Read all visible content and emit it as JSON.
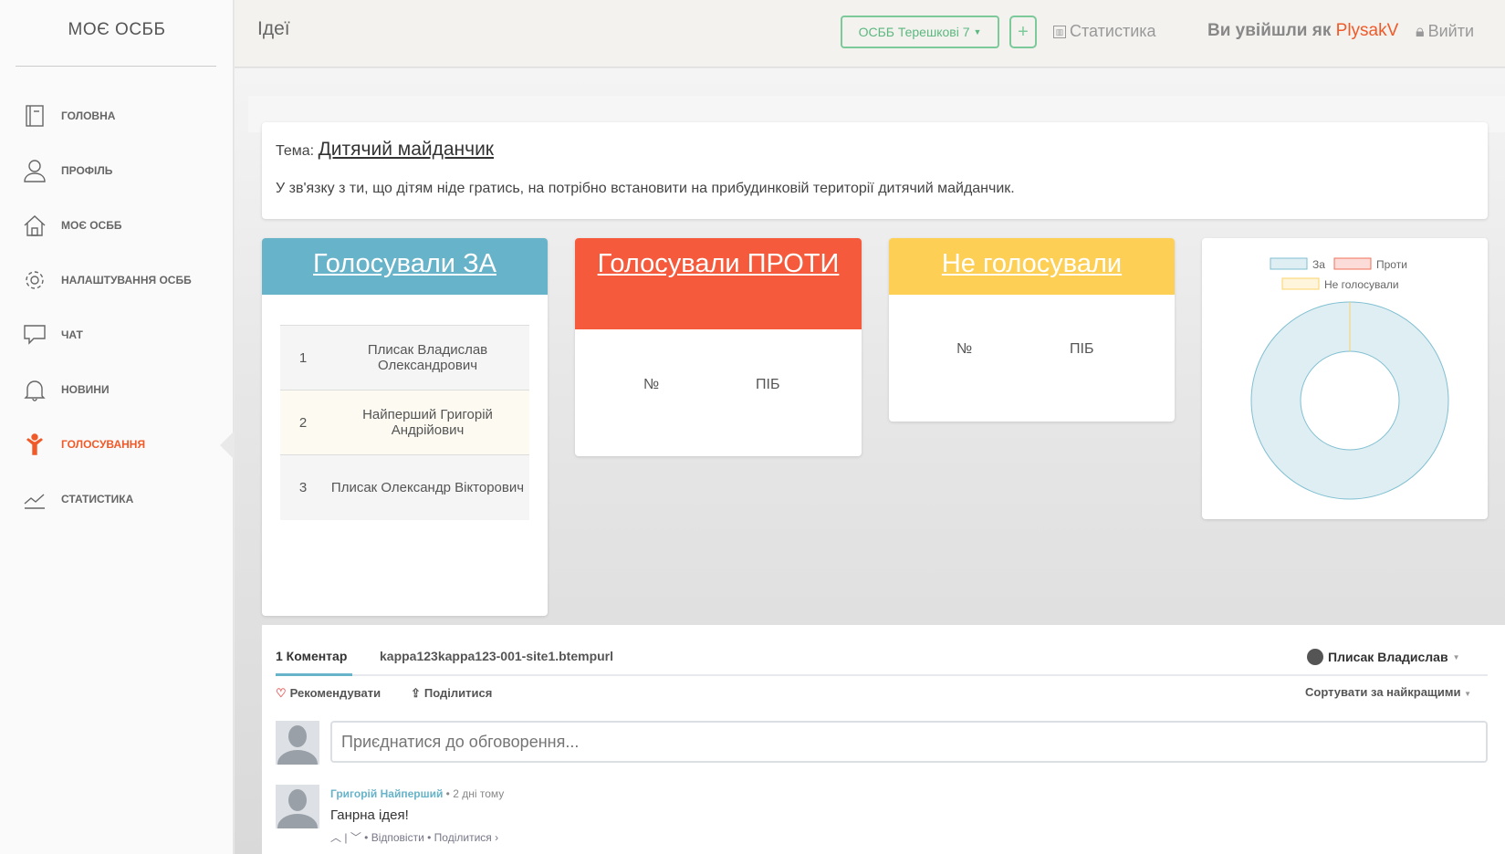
{
  "sidebar": {
    "brand": "МОЄ ОСББ",
    "items": [
      {
        "label": "Головна",
        "icon": "notebook-icon"
      },
      {
        "label": "Профіль",
        "icon": "user-icon"
      },
      {
        "label": "Моє ОСББ",
        "icon": "home-icon"
      },
      {
        "label": "Налаштування ОСББ",
        "icon": "gear-icon"
      },
      {
        "label": "Чат",
        "icon": "chat-icon"
      },
      {
        "label": "Новини",
        "icon": "bell-icon"
      },
      {
        "label": "Голосування",
        "icon": "person-vote-icon"
      },
      {
        "label": "Статистика",
        "icon": "chart-line-icon"
      }
    ],
    "active": 6
  },
  "header": {
    "title": "Ідеї",
    "osbb_select": "ОСББ Терешкові 7",
    "plus": "+",
    "stats": "Статистика",
    "logged_in_as": "Ви увійшли як",
    "username": "PlysakV",
    "logout": "Вийти"
  },
  "topic": {
    "label": "Тема:",
    "title": "Дитячий майданчик",
    "text": "У зв'язку з ти, що дітям ніде гратись, на потрібно встановити на прибудинковій території дитячий майданчик."
  },
  "votes": {
    "col_num": "№",
    "col_name": "ПІБ",
    "for": {
      "title": "Голосували ЗА",
      "color": "#67b3c9",
      "rows": [
        {
          "n": "1",
          "name": "Плисак Владислав Олександрович"
        },
        {
          "n": "2",
          "name": "Найперший Григорій Андрійович"
        },
        {
          "n": "3",
          "name": "Плисак Олександр Вікторович"
        }
      ]
    },
    "against": {
      "title": "Голосували ПРОТИ",
      "color": "#f55a3c"
    },
    "none": {
      "title": "Не голосували",
      "color": "#fecf55"
    }
  },
  "chart_data": {
    "type": "pie",
    "variant": "doughnut",
    "categories": [
      "За",
      "Проти",
      "Не голосували"
    ],
    "values": [
      3,
      0,
      0
    ],
    "colors": [
      "#dfeef3",
      "#fcdcd8",
      "#fff4dc"
    ],
    "borders": [
      "#7fbfd1",
      "#f0705a",
      "#fdd36a"
    ],
    "legend": "top"
  },
  "comments": {
    "count_label": "1 Коментар",
    "site": "kappa123kappa123-001-site1.btempurl",
    "user": "Плисак Владислав",
    "recommend": "Рекомендувати",
    "share": "Поділитися",
    "sort": "Сортувати за найкращими",
    "placeholder": "Приєднатися до обговорення...",
    "items": [
      {
        "author": "Григорій Найперший",
        "time": "2 дні тому",
        "text": "Ганрна ідея!",
        "reply": "Відповісти",
        "share": "Поділитися ›"
      }
    ]
  }
}
